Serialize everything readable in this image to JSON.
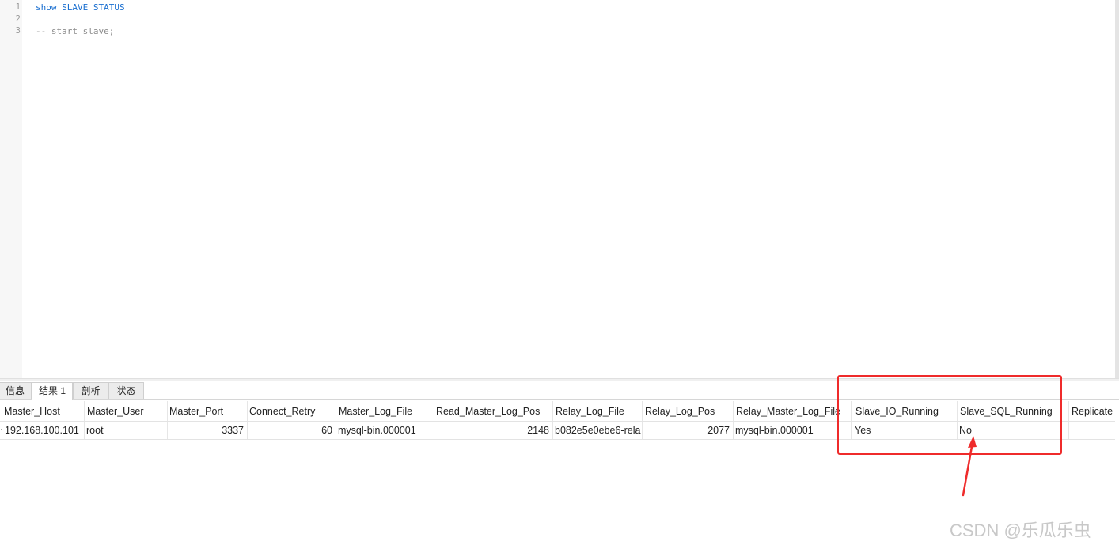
{
  "editor": {
    "line_numbers": [
      "1",
      "2",
      "3"
    ],
    "lines": [
      "show SLAVE STATUS",
      "",
      "-- start slave;"
    ]
  },
  "tabs": [
    "信息",
    "结果 1",
    "剖析",
    "状态"
  ],
  "active_tab": "结果 1",
  "table": {
    "columns": [
      "Master_Host",
      "Master_User",
      "Master_Port",
      "Connect_Retry",
      "Master_Log_File",
      "Read_Master_Log_Pos",
      "Relay_Log_File",
      "Relay_Log_Pos",
      "Relay_Master_Log_File",
      "Slave_IO_Running",
      "Slave_SQL_Running",
      "Replicate"
    ],
    "rows": [
      [
        "192.168.100.101",
        "root",
        "3337",
        "60",
        "mysql-bin.000001",
        "2148",
        "b082e5e0ebe6-rela",
        "2077",
        "mysql-bin.000001",
        "Yes",
        "No",
        ""
      ]
    ]
  },
  "annotation": {
    "highlighted_columns": [
      "Slave_IO_Running",
      "Slave_SQL_Running"
    ],
    "color": "#ef2b2b"
  },
  "watermark": "CSDN @乐瓜乐虫"
}
